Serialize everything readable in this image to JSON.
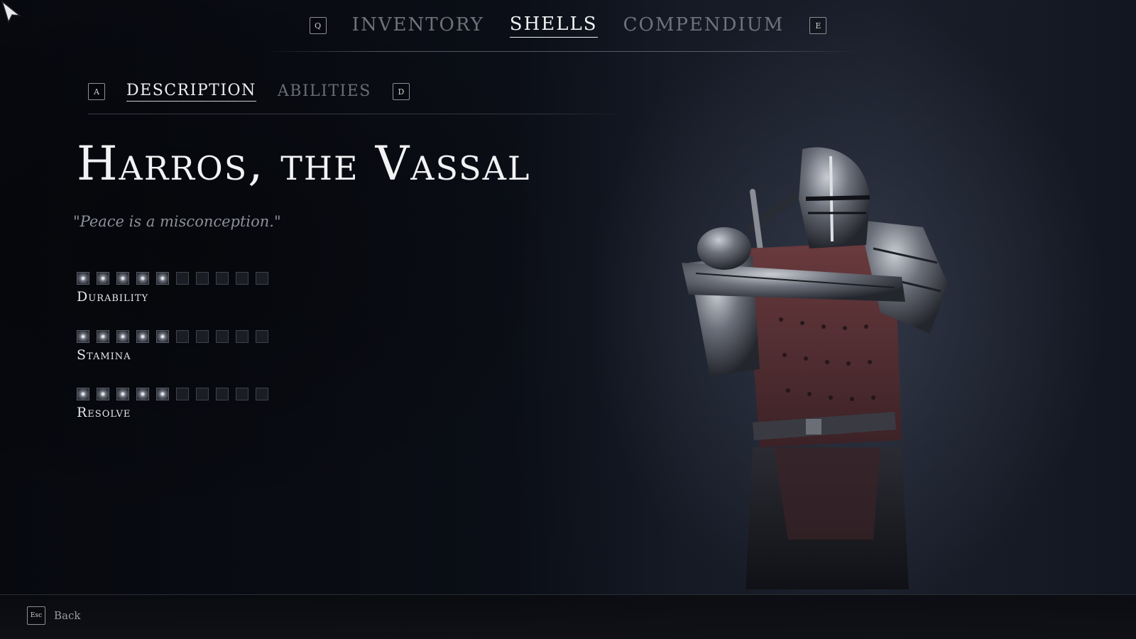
{
  "top_nav": {
    "prev_key": "Q",
    "tabs": [
      {
        "label": "INVENTORY",
        "active": false
      },
      {
        "label": "SHELLS",
        "active": true
      },
      {
        "label": "COMPENDIUM",
        "active": false
      }
    ],
    "next_key": "E"
  },
  "sub_nav": {
    "prev_key": "A",
    "tabs": [
      {
        "label": "DESCRIPTION",
        "active": true
      },
      {
        "label": "ABILITIES",
        "active": false
      }
    ],
    "next_key": "D"
  },
  "shell": {
    "name": "Harros, the Vassal",
    "quote": "\"Peace is a misconception.\"",
    "stats": [
      {
        "label": "Durability",
        "value": 5,
        "max": 10
      },
      {
        "label": "Stamina",
        "value": 5,
        "max": 10
      },
      {
        "label": "Resolve",
        "value": 5,
        "max": 10
      }
    ]
  },
  "footer": {
    "back_key": "Esc",
    "back_label": "Back"
  },
  "icons": {
    "cursor": "cursor-arrow-icon",
    "character": "armored-knight-figure"
  },
  "colors": {
    "active_text": "#f1f1f3",
    "inactive_text": "#6f727b",
    "background": "#06080d",
    "armor_leather": "#5a2f33"
  }
}
